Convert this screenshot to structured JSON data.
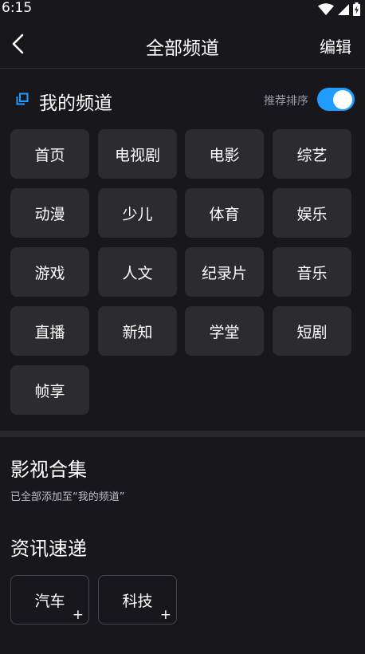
{
  "status": {
    "time": "6:15"
  },
  "header": {
    "title": "全部频道",
    "edit_label": "编辑"
  },
  "my_channels": {
    "title": "我的频道",
    "sort_label": "推荐排序",
    "sort_enabled": true,
    "items": [
      "首页",
      "电视剧",
      "电影",
      "综艺",
      "动漫",
      "少儿",
      "体育",
      "娱乐",
      "游戏",
      "人文",
      "纪录片",
      "音乐",
      "直播",
      "新知",
      "学堂",
      "短剧",
      "帧享"
    ]
  },
  "film_section": {
    "title": "影视合集",
    "subtitle": "已全部添加至“我的频道”"
  },
  "news_section": {
    "title": "资讯速递",
    "items": [
      "汽车",
      "科技"
    ]
  },
  "colors": {
    "accent": "#1f9dff",
    "background": "#18181c",
    "chip": "#2b2b30"
  }
}
